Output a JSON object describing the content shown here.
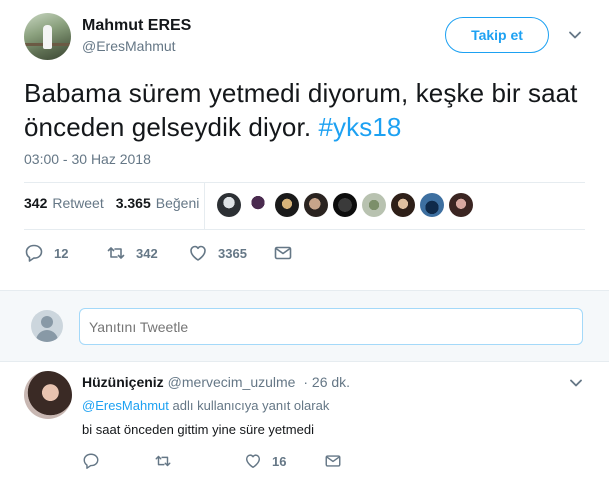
{
  "main_tweet": {
    "author_name": "Mahmut ERES",
    "author_handle": "@EresMahmut",
    "follow_label": "Takip et",
    "text": "Babama sürem yetmedi diyorum, keşke bir saat önceden gelseydik diyor.",
    "hashtag": "#yks18",
    "timestamp": "03:00 - 30 Haz 2018",
    "retweet_count": "342",
    "retweet_label": "Retweet",
    "like_count": "3.365",
    "like_label": "Beğeni",
    "actions": {
      "reply_count": "12",
      "retweet_count": "342",
      "like_count": "3365"
    }
  },
  "reply_box": {
    "placeholder": "Yanıtını Tweetle"
  },
  "reply_tweet": {
    "author_name": "Hüzüniçeniz",
    "author_handle": "@mervecim_uzulme",
    "time": "· 26 dk.",
    "replying_mention": "@EresMahmut",
    "replying_suffix": "adlı kullanıcıya yanıt olarak",
    "text": "bi saat önceden gittim yine süre yetmedi",
    "actions": {
      "reply_count": "",
      "retweet_count": "",
      "like_count": "16"
    }
  },
  "colors": {
    "accent": "#1da1f2",
    "muted": "#657786",
    "text": "#14171a",
    "reply_bg": "#f5f8fa"
  },
  "icons": {
    "reply": "speech-bubble-icon",
    "retweet": "retweet-icon",
    "like": "heart-icon",
    "dm": "envelope-icon",
    "more": "chevron-down-icon"
  }
}
